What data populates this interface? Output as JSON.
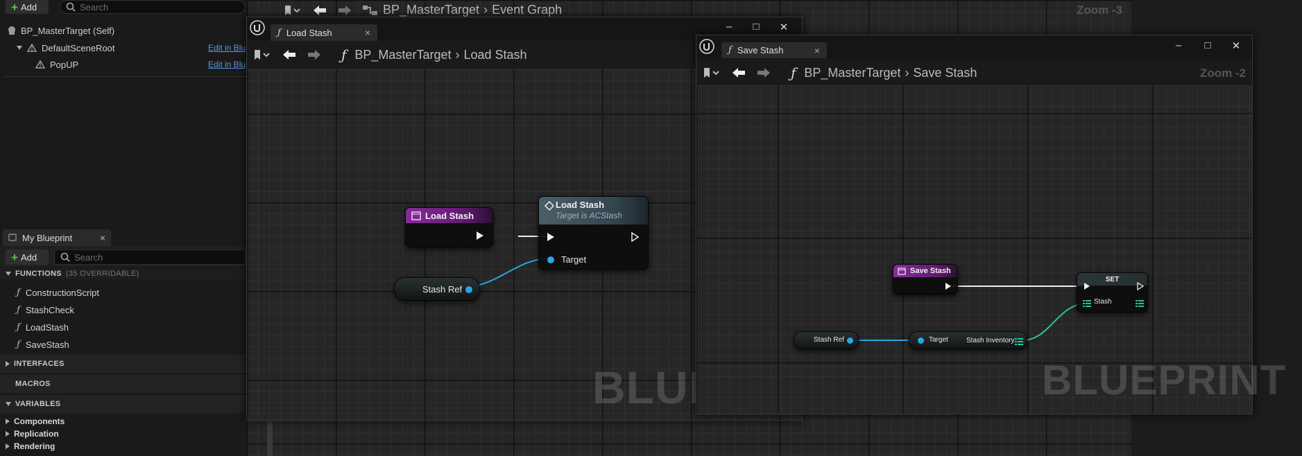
{
  "left_panel": {
    "add_label": "Add",
    "search_placeholder": "Search",
    "components": [
      {
        "name": "BP_MasterTarget (Self)"
      },
      {
        "name": "DefaultSceneRoot",
        "action": "Edit in Blu"
      },
      {
        "name": "PopUP",
        "action": "Edit in Blu"
      }
    ]
  },
  "my_blueprint": {
    "tab_label": "My Blueprint",
    "add_label": "Add",
    "search_placeholder": "Search",
    "functions_header": "FUNCTIONS",
    "functions_count": "(35 OVERRIDABLE)",
    "functions": [
      "ConstructionScript",
      "StashCheck",
      "LoadStash",
      "SaveStash"
    ],
    "interfaces_header": "INTERFACES",
    "macros_header": "MACROS",
    "variables_header": "VARIABLES",
    "variable_categories": [
      "Components",
      "Replication",
      "Rendering"
    ]
  },
  "main_graph": {
    "breadcrumb_root": "BP_MasterTarget",
    "breadcrumb_leaf": "Event Graph",
    "zoom": "Zoom -3"
  },
  "load_window": {
    "tab_label": "Load Stash",
    "breadcrumb_root": "BP_MasterTarget",
    "breadcrumb_leaf": "Load Stash",
    "watermark": "BLUEI",
    "nodes": {
      "entry_title": "Load Stash",
      "call_title": "Load Stash",
      "call_subtitle": "Target is ACStash",
      "call_pin_target": "Target",
      "var_stash_ref": "Stash Ref"
    }
  },
  "save_window": {
    "tab_label": "Save Stash",
    "breadcrumb_root": "BP_MasterTarget",
    "breadcrumb_leaf": "Save Stash",
    "zoom": "Zoom -2",
    "watermark": "BLUEPRINT",
    "nodes": {
      "entry_title": "Save Stash",
      "set_title": "SET",
      "set_pin_stash": "Stash",
      "var_stash_ref": "Stash Ref",
      "get_pin_target": "Target",
      "get_pin_stash_inventory": "Stash Inventory"
    }
  },
  "colors": {
    "function_entry": "#8a2a9c",
    "data_pin": "#2aa5e8",
    "array_pin": "#27c89a",
    "link": "#5a9ae6"
  }
}
